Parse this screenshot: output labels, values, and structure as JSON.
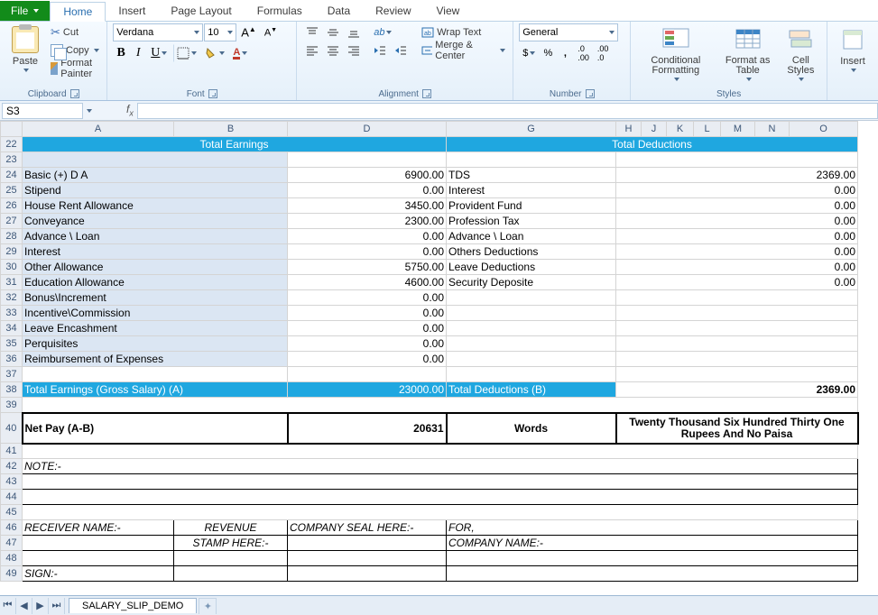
{
  "tabs": {
    "file": "File",
    "home": "Home",
    "insert": "Insert",
    "pagelayout": "Page Layout",
    "formulas": "Formulas",
    "data": "Data",
    "review": "Review",
    "view": "View"
  },
  "clipboard": {
    "paste": "Paste",
    "cut": "Cut",
    "copy": "Copy",
    "fmtpainter": "Format Painter",
    "group": "Clipboard"
  },
  "font": {
    "name": "Verdana",
    "size": "10",
    "group": "Font"
  },
  "alignment": {
    "wrap": "Wrap Text",
    "merge": "Merge & Center",
    "group": "Alignment"
  },
  "number": {
    "fmt": "General",
    "group": "Number"
  },
  "styles": {
    "cond": "Conditional Formatting",
    "table": "Format as Table",
    "cell": "Cell Styles",
    "group": "Styles"
  },
  "cells": {
    "insert": "Insert"
  },
  "namebox": "S3",
  "fx": "",
  "cols": [
    "A",
    "B",
    "D",
    "G",
    "H",
    "J",
    "K",
    "L",
    "M",
    "N",
    "O"
  ],
  "rows": [
    "22",
    "23",
    "24",
    "25",
    "26",
    "27",
    "28",
    "29",
    "30",
    "31",
    "32",
    "33",
    "34",
    "35",
    "36",
    "37",
    "38",
    "39",
    "40",
    "41",
    "42",
    "43",
    "44",
    "45",
    "46",
    "47",
    "48",
    "49"
  ],
  "header": {
    "earn": "Total Earnings",
    "ded": "Total Deductions"
  },
  "earn_items": [
    {
      "l": "Basic (+) D A",
      "v": "6900.00"
    },
    {
      "l": "Stipend",
      "v": "0.00"
    },
    {
      "l": "House Rent Allowance",
      "v": "3450.00"
    },
    {
      "l": "Conveyance",
      "v": "2300.00"
    },
    {
      "l": "Advance \\ Loan",
      "v": "0.00"
    },
    {
      "l": "Interest",
      "v": "0.00"
    },
    {
      "l": "Other Allowance",
      "v": "5750.00"
    },
    {
      "l": "Education Allowance",
      "v": "4600.00"
    },
    {
      "l": "Bonus\\Increment",
      "v": "0.00"
    },
    {
      "l": "Incentive\\Commission",
      "v": "0.00"
    },
    {
      "l": "Leave Encashment",
      "v": "0.00"
    },
    {
      "l": "Perquisites",
      "v": "0.00"
    },
    {
      "l": "Reimbursement of Expenses",
      "v": "0.00"
    }
  ],
  "ded_items": [
    {
      "l": "TDS",
      "v": "2369.00"
    },
    {
      "l": "Interest",
      "v": "0.00"
    },
    {
      "l": "Provident Fund",
      "v": "0.00"
    },
    {
      "l": "Profession Tax",
      "v": "0.00"
    },
    {
      "l": "Advance \\ Loan",
      "v": "0.00"
    },
    {
      "l": "Others Deductions",
      "v": "0.00"
    },
    {
      "l": "Leave Deductions",
      "v": "0.00"
    },
    {
      "l": "Security Deposite",
      "v": "0.00"
    }
  ],
  "tot": {
    "earn_l": "Total Earnings (Gross Salary) (A)",
    "earn_v": "23000.00",
    "ded_l": "Total Deductions (B)",
    "ded_v": "2369.00"
  },
  "net": {
    "l": "Net Pay (A-B)",
    "v": "20631",
    "words_l": "Words",
    "words_v": "Twenty Thousand Six Hundred Thirty One Rupees And No Paisa"
  },
  "note": "NOTE:-",
  "sig": {
    "recv": "RECEIVER NAME:-",
    "rev1": "REVENUE",
    "rev2": "STAMP HERE:-",
    "seal": "COMPANY SEAL HERE:-",
    "for": "FOR,",
    "co": "COMPANY NAME:-",
    "sign": "SIGN:-"
  },
  "sheet": "SALARY_SLIP_DEMO"
}
